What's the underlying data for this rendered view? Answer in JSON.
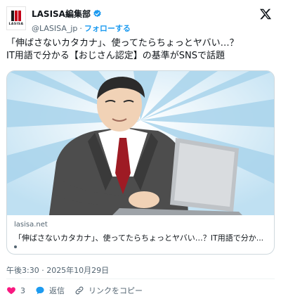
{
  "account": {
    "display_name": "LASISA編集部",
    "logo_text": "LASISA",
    "handle": "@LASISA_jp",
    "separator": "·",
    "follow_label": "フォローする"
  },
  "tweet": {
    "line1": "「伸ばさないカタカナ」、使ってたらちょっとヤバい…？",
    "line2": "IT用語で分かる【おじさん認定】の基準がSNSで話題"
  },
  "card": {
    "domain": "lasisa.net",
    "title": "「伸ばさないカタカナ」、使ってたらちょっとヤバい…？IT用語で分か..."
  },
  "timestamp": "午後3:30 · 2025年10月29日",
  "actions": {
    "like_count": "3",
    "reply_label": "返信",
    "copy_link_label": "リンクをコピー"
  },
  "colors": {
    "brand_red": "#c40018",
    "verified_blue": "#1d9bf0",
    "like_pink": "#f91880"
  }
}
